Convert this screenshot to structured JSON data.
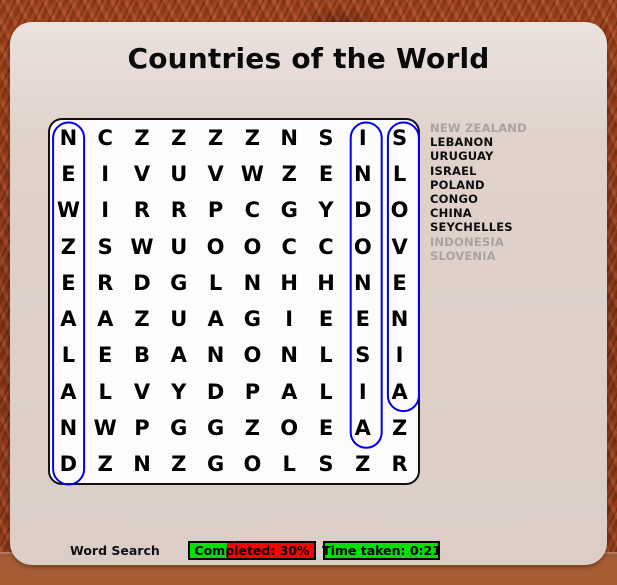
{
  "window": {
    "background_color": "#9c3d16",
    "panel_color": "#e0d2cb"
  },
  "header": {
    "title": "Countries of the World"
  },
  "grid": {
    "rows": 10,
    "cols": 10,
    "letters": [
      [
        "N",
        "C",
        "Z",
        "Z",
        "Z",
        "Z",
        "N",
        "S",
        "I",
        "S"
      ],
      [
        "E",
        "I",
        "V",
        "U",
        "V",
        "W",
        "Z",
        "E",
        "N",
        "L"
      ],
      [
        "W",
        "I",
        "R",
        "R",
        "P",
        "C",
        "G",
        "Y",
        "D",
        "O"
      ],
      [
        "Z",
        "S",
        "W",
        "U",
        "O",
        "O",
        "C",
        "C",
        "O",
        "V"
      ],
      [
        "E",
        "R",
        "D",
        "G",
        "L",
        "N",
        "H",
        "H",
        "N",
        "E"
      ],
      [
        "A",
        "A",
        "Z",
        "U",
        "A",
        "G",
        "I",
        "E",
        "E",
        "N"
      ],
      [
        "L",
        "E",
        "B",
        "A",
        "N",
        "O",
        "N",
        "L",
        "S",
        "I"
      ],
      [
        "A",
        "L",
        "V",
        "Y",
        "D",
        "P",
        "A",
        "L",
        "I",
        "A"
      ],
      [
        "N",
        "W",
        "P",
        "G",
        "G",
        "Z",
        "O",
        "E",
        "A",
        "Z"
      ],
      [
        "D",
        "Z",
        "N",
        "Z",
        "G",
        "O",
        "L",
        "S",
        "Z",
        "R"
      ]
    ],
    "highlight_color": "#0000ee",
    "found_marks": [
      {
        "word": "NEW ZEALAND",
        "col": 0,
        "row_start": 0,
        "row_end": 9
      },
      {
        "word": "INDONESIA",
        "col": 8,
        "row_start": 0,
        "row_end": 8
      },
      {
        "word": "SLOVENIA",
        "col": 9,
        "row_start": 0,
        "row_end": 7
      }
    ]
  },
  "wordlist": {
    "found_color": "#a9a2a0",
    "pending_color": "#0d0d0d",
    "words": [
      {
        "label": "NEW ZEALAND",
        "found": true
      },
      {
        "label": "LEBANON",
        "found": false
      },
      {
        "label": "URUGUAY",
        "found": false
      },
      {
        "label": "ISRAEL",
        "found": false
      },
      {
        "label": "POLAND",
        "found": false
      },
      {
        "label": "CONGO",
        "found": false
      },
      {
        "label": "CHINA",
        "found": false
      },
      {
        "label": "SEYCHELLES",
        "found": false
      },
      {
        "label": "INDONESIA",
        "found": true
      },
      {
        "label": "SLOVENIA",
        "found": true
      }
    ]
  },
  "status": {
    "app_label": "Word Search",
    "progress_text": "Completed: 30%",
    "progress_percent": 30,
    "progress_fill_color": "#00e000",
    "progress_track_color": "#ff0000",
    "timer_text": "Time taken: 0:21",
    "timer_color": "#00e000"
  }
}
